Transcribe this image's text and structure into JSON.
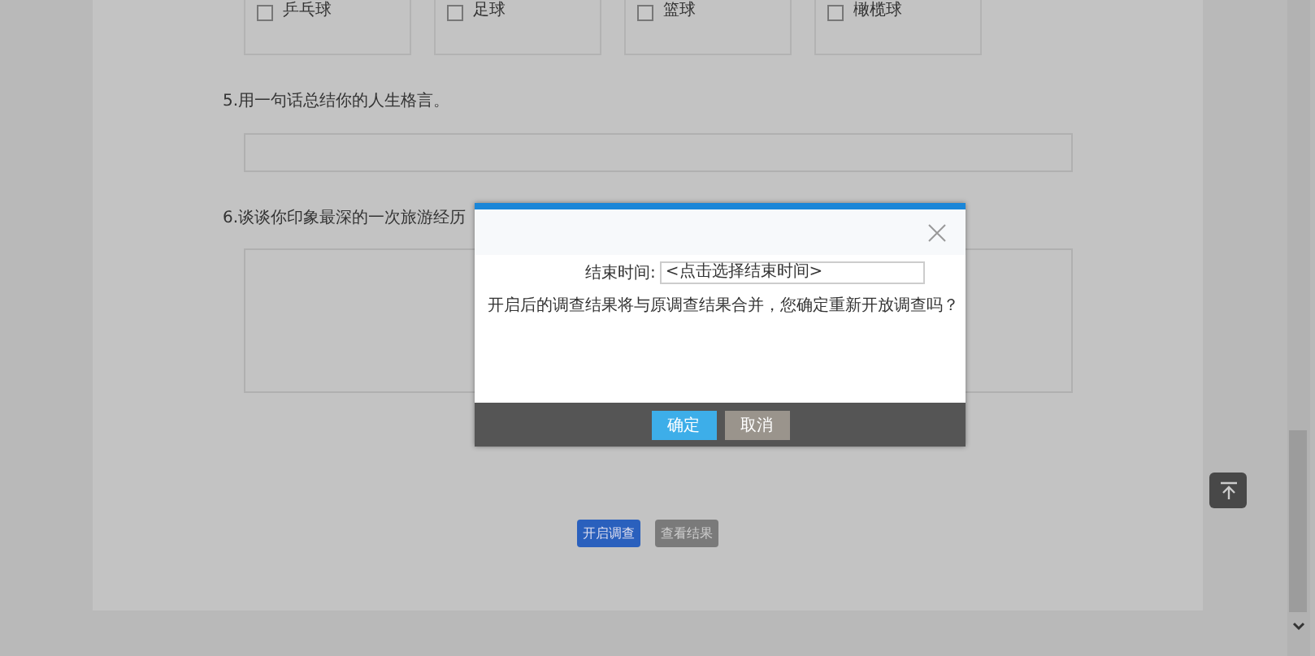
{
  "options": [
    {
      "label": "乒乓球",
      "checked": false
    },
    {
      "label": "足球",
      "checked": false
    },
    {
      "label": "篮球",
      "checked": false
    },
    {
      "label": "橄榄球",
      "checked": false
    }
  ],
  "questions": [
    {
      "kind": "input",
      "title": "5.用一句话总结你的人生格言。"
    },
    {
      "kind": "textarea",
      "title": "6.谈谈你印象最深的一次旅游经历"
    }
  ],
  "actions": [
    {
      "label": "开启调查",
      "kind": "primary"
    },
    {
      "label": "查看结果",
      "kind": "secondary"
    }
  ],
  "dialog": {
    "field_label": "结束时间:",
    "field_value": "<点击选择结束时间>",
    "message": "开启后的调查结果将与原调查结果合并，您确定重新开放调查吗？",
    "buttons": [
      {
        "label": "确定",
        "kind": "primary"
      },
      {
        "label": "取消",
        "kind": "secondary"
      }
    ]
  }
}
